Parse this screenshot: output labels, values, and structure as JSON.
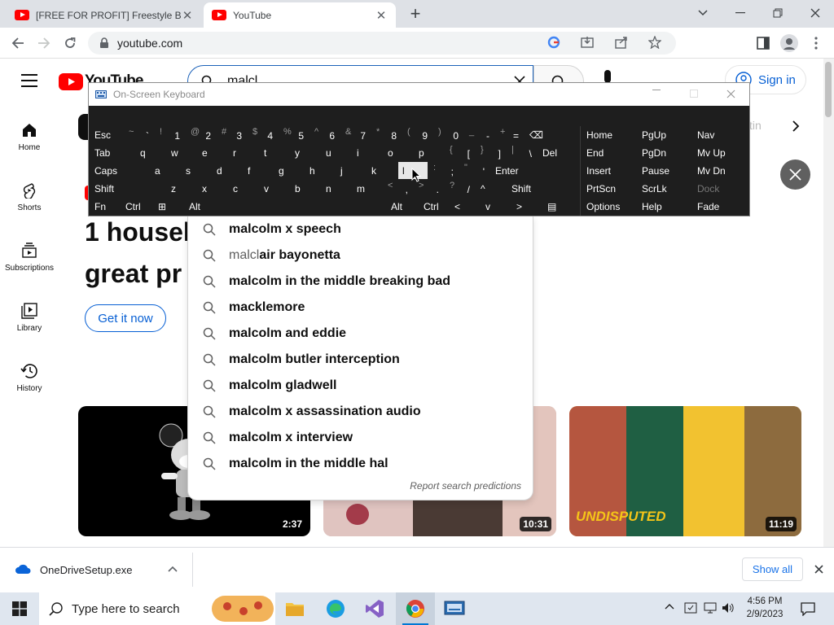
{
  "browser": {
    "tabs": [
      {
        "title": "[FREE FOR PROFIT] Freestyle Beat",
        "close": "✕"
      },
      {
        "title": "YouTube",
        "close": "✕"
      }
    ],
    "new_tab": "+",
    "url": "youtube.com"
  },
  "youtube": {
    "logo_text": "YouTube",
    "search_value": "malcl",
    "sign_in": "Sign in",
    "nav": [
      {
        "label": "Home"
      },
      {
        "label": "Shorts"
      },
      {
        "label": "Subscriptions"
      },
      {
        "label": "Library"
      },
      {
        "label": "History"
      }
    ],
    "chip_partial": "tin",
    "ad": {
      "headline_1": "1 househ",
      "headline_2": "great pr",
      "cta": "Get it now"
    },
    "videos": [
      {
        "duration": "2:37"
      },
      {
        "duration": "10:31"
      },
      {
        "duration": "11:19",
        "caption": "UNDISPUTED"
      }
    ]
  },
  "suggestions": {
    "typed": "malcl",
    "items": [
      {
        "pre": "",
        "text": "malcolm x speech"
      },
      {
        "pre": "malcl",
        "text": "air bayonetta"
      },
      {
        "pre": "",
        "text": "malcolm in the middle breaking bad"
      },
      {
        "pre": "",
        "text": "macklemore"
      },
      {
        "pre": "",
        "text": "malcolm and eddie"
      },
      {
        "pre": "",
        "text": "malcolm butler interception"
      },
      {
        "pre": "",
        "text": "malcolm gladwell"
      },
      {
        "pre": "",
        "text": "malcolm x assassination audio"
      },
      {
        "pre": "",
        "text": "malcolm x interview"
      },
      {
        "pre": "",
        "text": "malcolm in the middle hal"
      }
    ],
    "report": "Report search predictions"
  },
  "osk": {
    "title": "On-Screen Keyboard",
    "row1": [
      {
        "m": "Esc"
      },
      {
        "s": "~",
        "m": "`"
      },
      {
        "s": "!",
        "m": "1"
      },
      {
        "s": "@",
        "m": "2"
      },
      {
        "s": "#",
        "m": "3"
      },
      {
        "s": "$",
        "m": "4"
      },
      {
        "s": "%",
        "m": "5"
      },
      {
        "s": "^",
        "m": "6"
      },
      {
        "s": "&",
        "m": "7"
      },
      {
        "s": "*",
        "m": "8"
      },
      {
        "s": "(",
        "m": "9"
      },
      {
        "s": ")",
        "m": "0"
      },
      {
        "s": "_",
        "m": "-"
      },
      {
        "s": "+",
        "m": "="
      },
      {
        "m": "⌫"
      }
    ],
    "row2": [
      {
        "m": "Tab"
      },
      {
        "m": "q"
      },
      {
        "m": "w"
      },
      {
        "m": "e"
      },
      {
        "m": "r"
      },
      {
        "m": "t"
      },
      {
        "m": "y"
      },
      {
        "m": "u"
      },
      {
        "m": "i"
      },
      {
        "m": "o"
      },
      {
        "m": "p"
      },
      {
        "s": "{",
        "m": "["
      },
      {
        "s": "}",
        "m": "]"
      },
      {
        "s": "|",
        "m": "\\"
      },
      {
        "m": "Del"
      }
    ],
    "row3": [
      {
        "m": "Caps"
      },
      {
        "m": "a"
      },
      {
        "m": "s"
      },
      {
        "m": "d"
      },
      {
        "m": "f"
      },
      {
        "m": "g"
      },
      {
        "m": "h"
      },
      {
        "m": "j"
      },
      {
        "m": "k"
      },
      {
        "m": "l"
      },
      {
        "s": ":",
        "m": ";"
      },
      {
        "s": "\"",
        "m": "'"
      },
      {
        "m": "Enter"
      }
    ],
    "row4": [
      {
        "m": "Shift"
      },
      {
        "m": "z"
      },
      {
        "m": "x"
      },
      {
        "m": "c"
      },
      {
        "m": "v"
      },
      {
        "m": "b"
      },
      {
        "m": "n"
      },
      {
        "m": "m"
      },
      {
        "s": "<",
        "m": ","
      },
      {
        "s": ">",
        "m": "."
      },
      {
        "s": "?",
        "m": "/"
      },
      {
        "m": "^"
      },
      {
        "m": "Shift"
      }
    ],
    "row5": [
      {
        "m": "Fn"
      },
      {
        "m": "Ctrl"
      },
      {
        "m": "⊞"
      },
      {
        "m": "Alt"
      },
      {
        "m": ""
      },
      {
        "m": "Alt"
      },
      {
        "m": "Ctrl"
      },
      {
        "m": "<"
      },
      {
        "m": "v"
      },
      {
        "m": ">"
      },
      {
        "m": "▤"
      }
    ],
    "nav_cols": [
      [
        "Home",
        "PgUp",
        "Nav"
      ],
      [
        "End",
        "PgDn",
        "Mv Up"
      ],
      [
        "Insert",
        "Pause",
        "Mv Dn"
      ],
      [
        "PrtScn",
        "ScrLk",
        "Dock"
      ],
      [
        "Options",
        "Help",
        "Fade"
      ]
    ],
    "highlighted_key": "l"
  },
  "downloads": {
    "file": "OneDriveSetup.exe",
    "show_all": "Show all"
  },
  "taskbar": {
    "search_placeholder": "Type here to search",
    "time": "4:56 PM",
    "date": "2/9/2023"
  },
  "colors": {
    "yt_red": "#ff0000",
    "osk_bg": "#1e1e1e",
    "link_blue": "#065fd4",
    "taskbar": "#dfe6ef"
  }
}
